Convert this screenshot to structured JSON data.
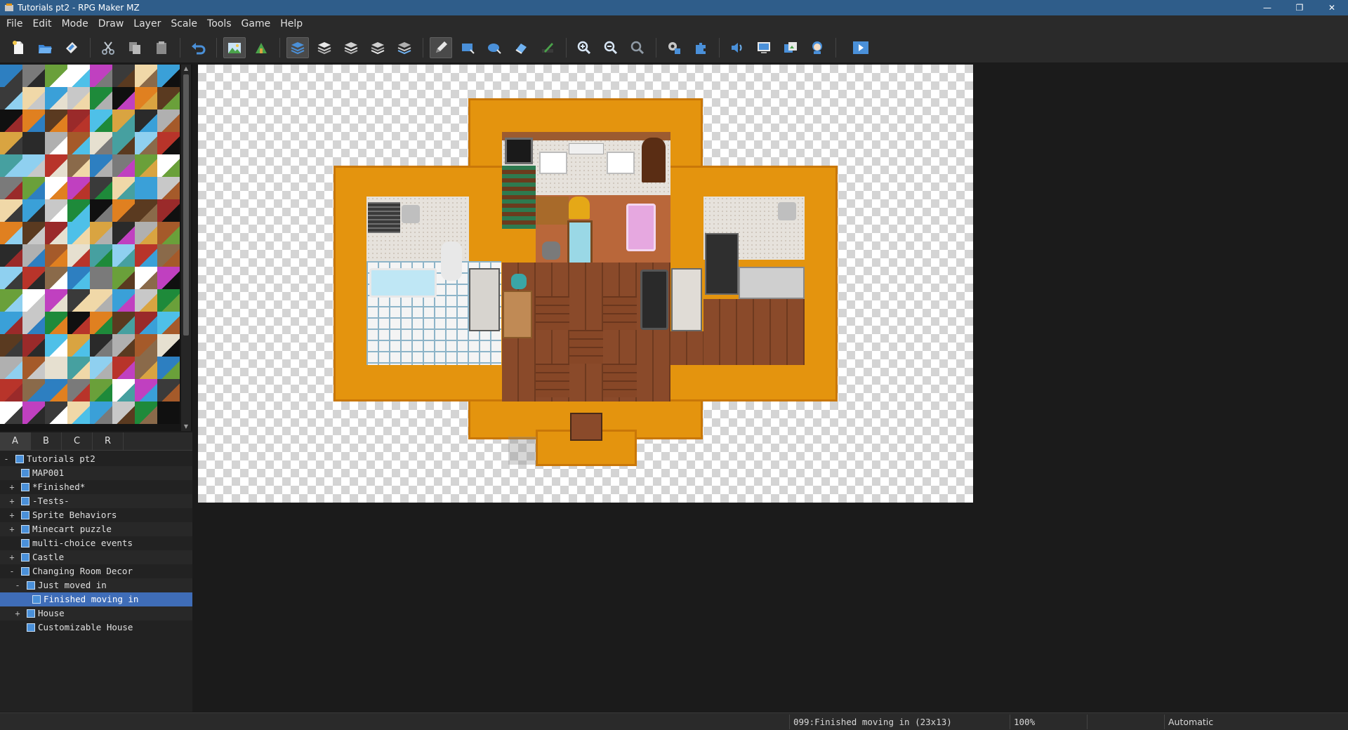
{
  "window": {
    "title": "Tutorials pt2 - RPG Maker MZ",
    "minimize": "—",
    "restore": "❐",
    "close": "✕"
  },
  "menu": [
    "File",
    "Edit",
    "Mode",
    "Draw",
    "Layer",
    "Scale",
    "Tools",
    "Game",
    "Help"
  ],
  "toolbar": {
    "buttons": [
      {
        "name": "new-project-icon",
        "glyph": "🗋"
      },
      {
        "name": "open-project-icon",
        "glyph": "📂"
      },
      {
        "name": "save-project-icon",
        "glyph": "💾"
      },
      {
        "name": "cut-icon",
        "glyph": "✂"
      },
      {
        "name": "copy-icon",
        "glyph": "⧉"
      },
      {
        "name": "paste-icon",
        "glyph": "📋"
      },
      {
        "name": "undo-icon",
        "glyph": "↶"
      },
      {
        "name": "map-mode-icon",
        "glyph": "⛰"
      },
      {
        "name": "event-mode-icon",
        "glyph": "♞"
      },
      {
        "name": "auto-layer-icon",
        "glyph": "≋"
      },
      {
        "name": "layer-1-icon",
        "glyph": "≋"
      },
      {
        "name": "layer-2-icon",
        "glyph": "≋"
      },
      {
        "name": "layer-3-icon",
        "glyph": "≋"
      },
      {
        "name": "layer-4-icon",
        "glyph": "≋"
      },
      {
        "name": "pencil-icon",
        "glyph": "✎"
      },
      {
        "name": "rectangle-icon",
        "glyph": "▭"
      },
      {
        "name": "ellipse-icon",
        "glyph": "⬭"
      },
      {
        "name": "flood-fill-icon",
        "glyph": "◈"
      },
      {
        "name": "shadow-pen-icon",
        "glyph": "✐"
      },
      {
        "name": "zoom-in-icon",
        "glyph": "⊕"
      },
      {
        "name": "zoom-out-icon",
        "glyph": "⊖"
      },
      {
        "name": "actual-size-icon",
        "glyph": "⊙"
      },
      {
        "name": "database-icon",
        "glyph": "⚙"
      },
      {
        "name": "plugin-manager-icon",
        "glyph": "✱"
      },
      {
        "name": "sound-test-icon",
        "glyph": "🔊"
      },
      {
        "name": "event-searcher-icon",
        "glyph": "▣"
      },
      {
        "name": "resource-manager-icon",
        "glyph": "🗀"
      },
      {
        "name": "character-generator-icon",
        "glyph": "☺"
      },
      {
        "name": "playtest-icon",
        "glyph": "▶"
      }
    ],
    "accent": "#4a90d9"
  },
  "tileset_tabs": [
    "A",
    "B",
    "C",
    "R"
  ],
  "tileset_tab_active": "A",
  "map_tree": [
    {
      "label": "Tutorials pt2",
      "expander": "-",
      "depth": 0,
      "root": true
    },
    {
      "label": "MAP001",
      "expander": "",
      "depth": 1
    },
    {
      "label": "*Finished*",
      "expander": "+",
      "depth": 1
    },
    {
      "label": "-Tests-",
      "expander": "+",
      "depth": 1
    },
    {
      "label": "Sprite Behaviors",
      "expander": "+",
      "depth": 1
    },
    {
      "label": "Minecart puzzle",
      "expander": "+",
      "depth": 1
    },
    {
      "label": "multi-choice events",
      "expander": "",
      "depth": 1
    },
    {
      "label": "Castle",
      "expander": "+",
      "depth": 1
    },
    {
      "label": "Changing Room Decor",
      "expander": "-",
      "depth": 1
    },
    {
      "label": "Just moved in",
      "expander": "-",
      "depth": 2
    },
    {
      "label": "Finished moving in",
      "expander": "",
      "depth": 3,
      "selected": true
    },
    {
      "label": "House",
      "expander": "+",
      "depth": 2
    },
    {
      "label": "Customizable House",
      "expander": "",
      "depth": 2
    }
  ],
  "status": {
    "map_info": "099:Finished moving in (23x13)",
    "zoom": "100%",
    "mode": "Automatic"
  },
  "colors": {
    "titlebar": "#2f5d8a",
    "selection": "#3f6db8",
    "wall": "#e4940e",
    "wood_floor": "#8a4a2a"
  }
}
